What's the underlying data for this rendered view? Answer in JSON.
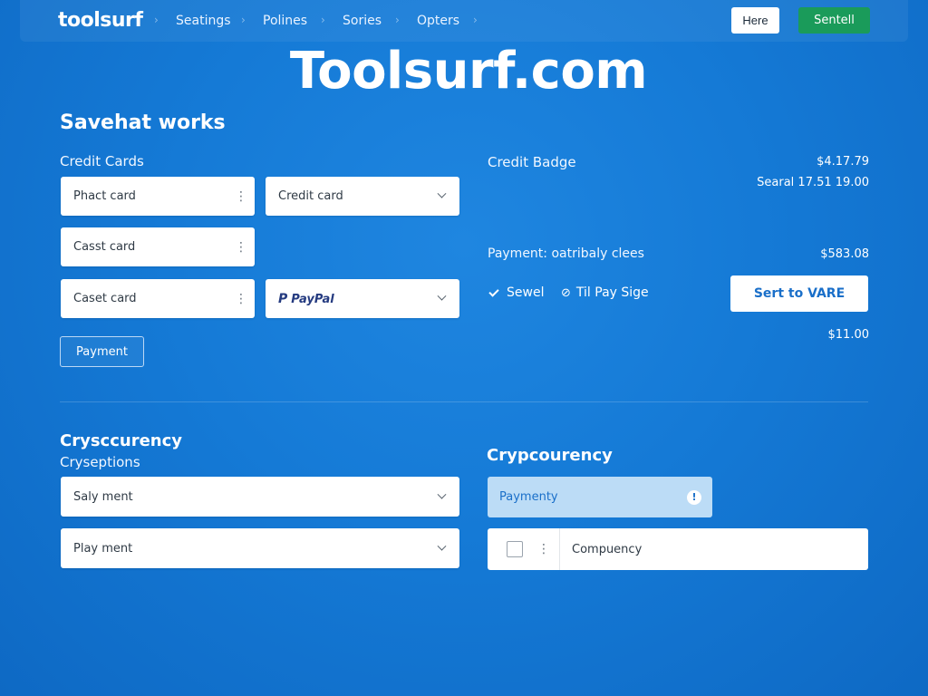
{
  "nav": {
    "logo": "toolsurf",
    "items": [
      "Seatings",
      "Polines",
      "Sories",
      "Opters"
    ],
    "here_button": "Here",
    "sentell_button": "Sentell"
  },
  "hero": {
    "title": "Toolsurf.com"
  },
  "left": {
    "section_title": "Savehat works",
    "credit_cards_label": "Credit Cards",
    "field_1": "Phact card",
    "field_2": "Credit card",
    "field_3": "Casst card",
    "field_4": "Caset card",
    "paypal_a": "Pay",
    "paypal_b": "Pal",
    "paypal_mark": "P",
    "payment_button": "Payment"
  },
  "right": {
    "credit_badge_label": "Credit Badge",
    "amount_1": "$4.17.79",
    "amount_2": "Searal 17.51 19.00",
    "payment_line": "Payment: oatribaly clees",
    "amount_3": "$583.08",
    "option_1": "Sewel",
    "option_2": "Til Pay Sige",
    "vare_button": "Sert to VARE",
    "amount_4": "$11.00"
  },
  "crypto_left": {
    "title": "Crysccurency",
    "subtitle": "Cryseptions",
    "select_1": "Saly ment",
    "select_2": "Play ment"
  },
  "crypto_right": {
    "title": "Crypcourency",
    "payment_chip": "Paymenty",
    "info_glyph": "!",
    "row_text": "Compuency"
  },
  "icons": {
    "kebab": "⋮",
    "link": "⊘"
  },
  "colors": {
    "background": "#157ad6",
    "accent_green": "#1a9b5a",
    "chip_blue": "#bcdcf6",
    "paypal_dark": "#253b80",
    "paypal_light": "#179bd7"
  }
}
